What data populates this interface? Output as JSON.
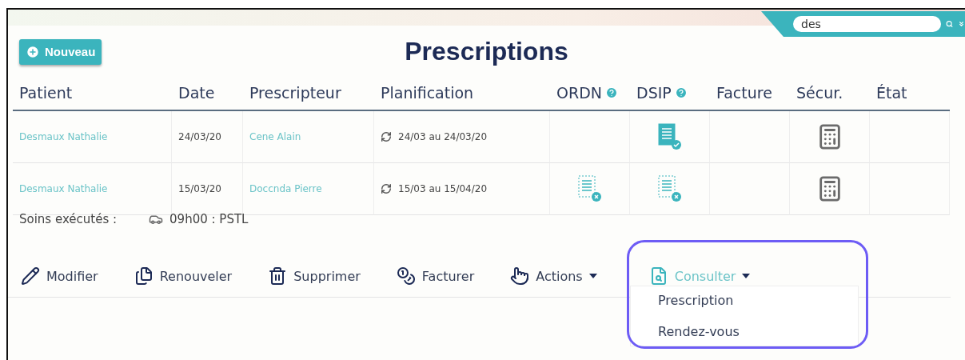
{
  "search": {
    "value": "des"
  },
  "new_button": "Nouveau",
  "title": "Prescriptions",
  "columns": [
    {
      "label": "Patient",
      "help": false
    },
    {
      "label": "Date",
      "help": false
    },
    {
      "label": "Prescripteur",
      "help": false
    },
    {
      "label": "Planification",
      "help": false
    },
    {
      "label": "ORDN",
      "help": true
    },
    {
      "label": "DSIP",
      "help": true
    },
    {
      "label": "Facture",
      "help": false
    },
    {
      "label": "Sécur.",
      "help": false
    },
    {
      "label": "État",
      "help": false
    }
  ],
  "rows": [
    {
      "patient": "Desmaux Nathalie",
      "date": "24/03/20",
      "prescriber": "Cene Alain",
      "planning": "24/03 au 24/03/20",
      "dsip": {
        "valid": true
      },
      "secure": true
    },
    {
      "patient": "Desmaux Nathalie",
      "date": "15/03/20",
      "prescriber": "Doccnda Pierre",
      "planning": "15/03 au 15/04/20",
      "ordn": {
        "valid": false
      },
      "dsip": {
        "valid": false
      },
      "secure": true
    }
  ],
  "care": {
    "label": "Soins exécutés :",
    "entry": "09h00 : PSTL"
  },
  "actions": [
    {
      "kind": "edit",
      "label": "Modifier",
      "dropdown": false,
      "selected": false
    },
    {
      "kind": "renew",
      "label": "Renouveler",
      "dropdown": false,
      "selected": false
    },
    {
      "kind": "delete",
      "label": "Supprimer",
      "dropdown": false,
      "selected": false
    },
    {
      "kind": "bill",
      "label": "Facturer",
      "dropdown": false,
      "selected": false
    },
    {
      "kind": "actions",
      "label": "Actions",
      "dropdown": true,
      "selected": false
    },
    {
      "kind": "consult",
      "label": "Consulter",
      "dropdown": true,
      "selected": true
    }
  ],
  "menu": {
    "items": [
      "Prescription",
      "Rendez-vous"
    ]
  }
}
